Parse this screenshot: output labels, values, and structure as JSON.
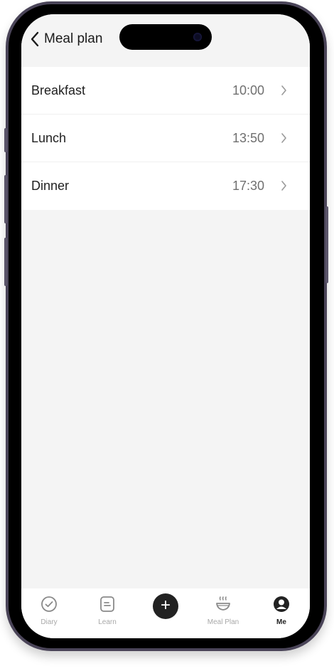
{
  "header": {
    "back_label": "Meal plan"
  },
  "meals": [
    {
      "label": "Breakfast",
      "time": "10:00"
    },
    {
      "label": "Lunch",
      "time": "13:50"
    },
    {
      "label": "Dinner",
      "time": "17:30"
    }
  ],
  "tabbar": {
    "diary": "Diary",
    "learn": "Learn",
    "add": "+",
    "meal_plan": "Meal Plan",
    "me": "Me"
  },
  "icons": {
    "back": "chevron-left-icon",
    "row": "chevron-right-icon",
    "diary": "check-circle-icon",
    "learn": "note-icon",
    "add": "plus-icon",
    "meal_plan": "steaming-bowl-icon",
    "me": "user-icon"
  },
  "colors": {
    "background": "#f4f4f4",
    "accent": "#222222",
    "inactive": "#a8a8a8"
  }
}
